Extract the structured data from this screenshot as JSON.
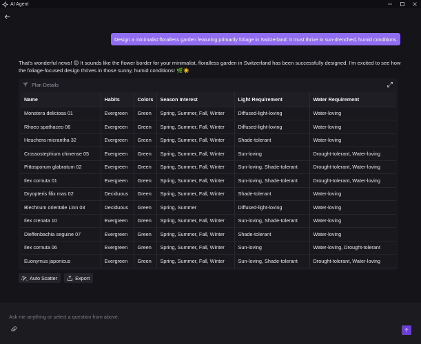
{
  "window": {
    "title": "AI Agent",
    "controls": [
      "minimize-icon",
      "maximize-icon",
      "close-icon"
    ]
  },
  "chat": {
    "user_message": "Design a minimalist floralless garden featuring primarily foliage in Switzerland. It must thrive in sun-drenched, humid conditions.",
    "assistant_message": "That's wonderful news! 😊 It sounds like the flower border for your minimalist, floralless garden in Switzerland has been successfully designed. I'm excited to see how the foliage-focused design thrives in those sunny, humid conditions! 🌿☀️"
  },
  "plan": {
    "title": "Plan Details",
    "columns": [
      "Name",
      "Habits",
      "Colors",
      "Season Interest",
      "Light Requirement",
      "Water Requirement"
    ],
    "rows": [
      [
        "Monstera deliciosa 01",
        "Evergreen",
        "Green",
        "Spring, Summer, Fall, Winter",
        "Diffused-light-loving",
        "Water-loving"
      ],
      [
        "Rhoeo spathaceo 06",
        "Evergreen",
        "Green",
        "Spring, Summer, Fall, Winter",
        "Diffused-light-loving",
        "Water-loving"
      ],
      [
        "Heuchera micrantha 32",
        "Evergreen",
        "Green",
        "Spring, Summer, Fall, Winter",
        "Shade-tolerant",
        "Water-loving"
      ],
      [
        "Crossostephium chinense 05",
        "Evergreen",
        "Green",
        "Spring, Summer, Fall, Winter",
        "Sun-loving",
        "Drought-tolerant, Water-loving"
      ],
      [
        "Pittosporum glabratum 02",
        "Evergreen",
        "Green",
        "Spring, Summer, Fall, Winter",
        "Sun-loving, Shade-tolerant",
        "Drought-tolerant, Water-loving"
      ],
      [
        "Ilex cornuta 01",
        "Evergreen",
        "Green",
        "Spring, Summer, Fall, Winter",
        "Sun-loving, Shade-tolerant",
        "Drought-tolerant, Water-loving"
      ],
      [
        "Dryopteris filix mas 02",
        "Deciduous",
        "Green",
        "Spring, Summer, Fall, Winter",
        "Shade-tolerant",
        "Water-loving"
      ],
      [
        "Blechnum orientale Linn 03",
        "Deciduous",
        "Green",
        "Spring, Summer",
        "Diffused-light-loving",
        "Water-loving"
      ],
      [
        "Ilex crenata 10",
        "Evergreen",
        "Green",
        "Spring, Summer, Fall, Winter",
        "Sun-loving, Shade-tolerant",
        "Water-loving"
      ],
      [
        "Dieffenbachia seguine 07",
        "Evergreen",
        "Green",
        "Spring, Summer, Fall, Winter",
        "Shade-tolerant",
        "Water-loving"
      ],
      [
        "Ilex cornuta 06",
        "Evergreen",
        "Green",
        "Spring, Summer, Fall, Winter",
        "Sun-loving",
        "Water-loving, Drought-tolerant"
      ],
      [
        "Euonymus japonicus",
        "Evergreen",
        "Green",
        "Spring, Summer, Fall, Winter",
        "Sun-loving, Shade-tolerant",
        "Drought-tolerant, Water-loving"
      ]
    ]
  },
  "actions": {
    "auto_scatter": "Auto Scatter",
    "export": "Export"
  },
  "input": {
    "placeholder": "Ask me anything or select a question from above."
  },
  "colors": {
    "accent": "#8f6cf0",
    "send": "#6b3fd6",
    "background": "#141419"
  }
}
